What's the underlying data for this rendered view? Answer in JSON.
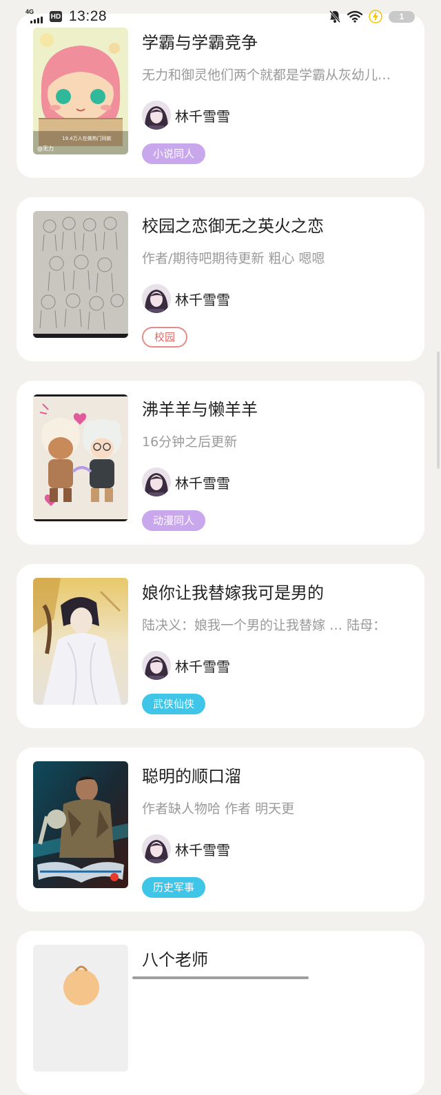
{
  "status_bar": {
    "network": "4G",
    "hd": "HD",
    "time": "13:28",
    "battery": "1",
    "icons": [
      "signal-icon",
      "mute-bell-icon",
      "wifi-icon",
      "charging-icon",
      "battery-icon"
    ]
  },
  "books": [
    {
      "title": "学霸与学霸竞争",
      "desc": "无力和御灵他们两个就都是学霸从灰幼儿园开始就是",
      "author": "林千雪雪",
      "tag": "小说同人",
      "tag_style": "fill-purple",
      "cover_icon": "cartoon-pink-hair-girl-cover",
      "cover_caption": "19.4万人在做热门同款",
      "cover_watermark": "@无力"
    },
    {
      "title": "校园之恋御无之英火之恋",
      "desc": "作者/期待吧期待更新  粗心  嗯嗯",
      "author": "林千雪雪",
      "tag": "校园",
      "tag_style": "outline-red",
      "cover_icon": "pencil-sketch-characters-cover"
    },
    {
      "title": "沸羊羊与懒羊羊",
      "desc": "16分钟之后更新",
      "author": "林千雪雪",
      "tag": "动漫同人",
      "tag_style": "fill-purple",
      "cover_icon": "chibi-sheep-hearts-cover"
    },
    {
      "title": "娘你让我替嫁我可是男的",
      "desc": "陆决义：娘我一个男的让我替嫁 … 陆母：",
      "author": "林千雪雪",
      "tag": "武侠仙侠",
      "tag_style": "fill-cyan",
      "cover_icon": "white-robed-swordsman-cover"
    },
    {
      "title": "聪明的顺口溜",
      "desc": "作者缺人物哈  作者  明天更",
      "author": "林千雪雪",
      "tag": "历史军事",
      "tag_style": "fill-cyan",
      "cover_icon": "soldier-action-poster-cover"
    },
    {
      "title": "八个老师",
      "cover_icon": "cartoon-head-cover"
    }
  ]
}
